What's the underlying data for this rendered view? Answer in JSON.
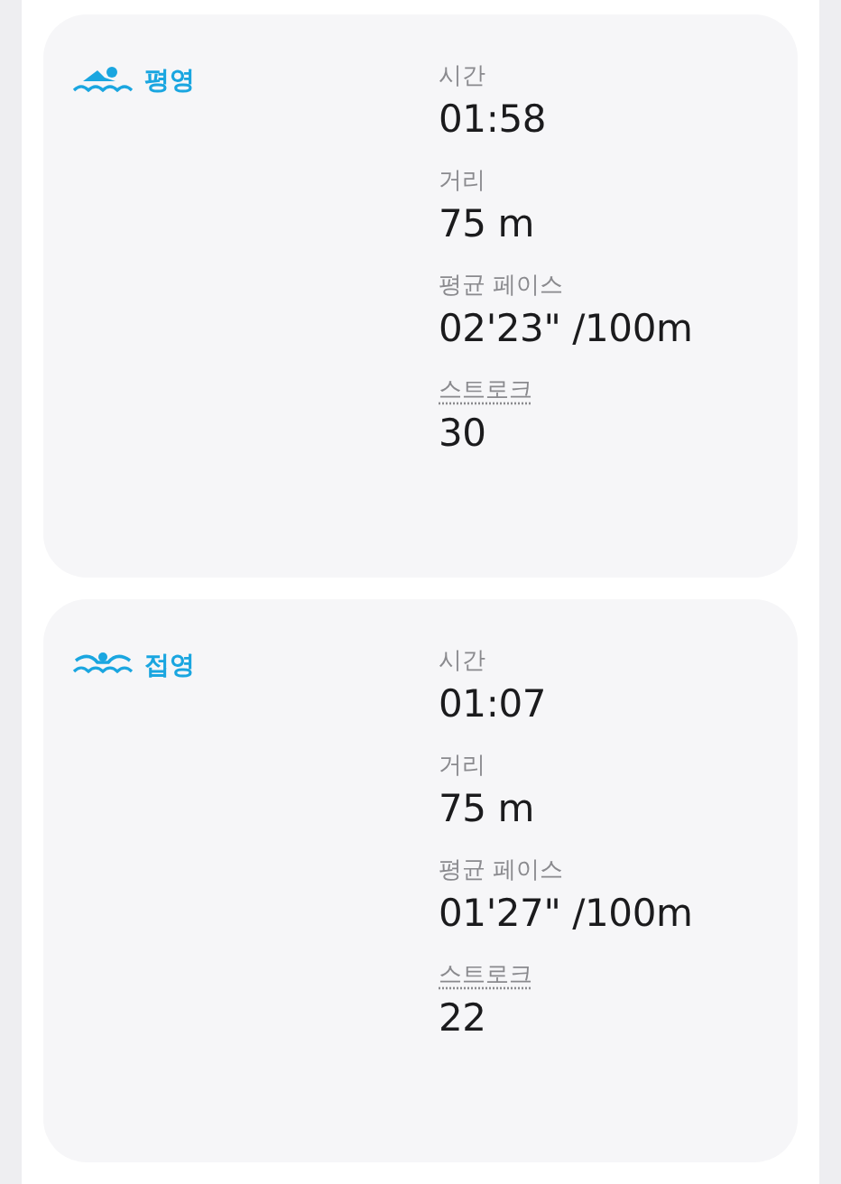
{
  "workouts": [
    {
      "kind": "breaststroke",
      "title": "평영",
      "stats": [
        {
          "label": "시간",
          "value": "01:58",
          "kind": "plain"
        },
        {
          "label": "거리",
          "value": "75 m",
          "kind": "plain"
        },
        {
          "label": "평균 페이스",
          "value": "02'23\" /100m",
          "kind": "plain"
        },
        {
          "label": "스트로크",
          "value": "30",
          "kind": "link"
        }
      ]
    },
    {
      "kind": "butterfly",
      "title": "접영",
      "stats": [
        {
          "label": "시간",
          "value": "01:07",
          "kind": "plain"
        },
        {
          "label": "거리",
          "value": "75 m",
          "kind": "plain"
        },
        {
          "label": "평균 페이스",
          "value": "01'27\" /100m",
          "kind": "plain"
        },
        {
          "label": "스트로크",
          "value": "22",
          "kind": "link"
        }
      ]
    }
  ]
}
